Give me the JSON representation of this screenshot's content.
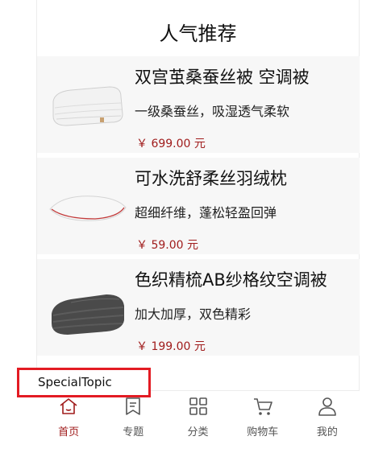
{
  "header": {
    "title": "人气推荐"
  },
  "products": [
    {
      "name": "双宫茧桑蚕丝被 空调被",
      "desc": "一级桑蚕丝，吸湿透气柔软",
      "price": "￥ 699.00 元",
      "image": "white-quilt"
    },
    {
      "name": "可水洗舒柔丝羽绒枕",
      "desc": "超细纤维，蓬松轻盈回弹",
      "price": "￥ 59.00 元",
      "image": "white-pillow"
    },
    {
      "name": "色织精梳AB纱格纹空调被",
      "desc": "加大加厚，双色精彩",
      "price": "￥ 199.00 元",
      "image": "grey-blanket"
    }
  ],
  "tooltip": {
    "text": "SpecialTopic"
  },
  "tabbar": {
    "tabs": [
      {
        "label": "首页",
        "icon": "home-icon",
        "active": true
      },
      {
        "label": "专题",
        "icon": "topic-icon",
        "active": false
      },
      {
        "label": "分类",
        "icon": "category-icon",
        "active": false
      },
      {
        "label": "购物车",
        "icon": "cart-icon",
        "active": false
      },
      {
        "label": "我的",
        "icon": "user-icon",
        "active": false
      }
    ]
  },
  "colors": {
    "accent": "#a01c1c",
    "highlight_border": "#e31b23",
    "card_bg": "#f7f7f7"
  }
}
